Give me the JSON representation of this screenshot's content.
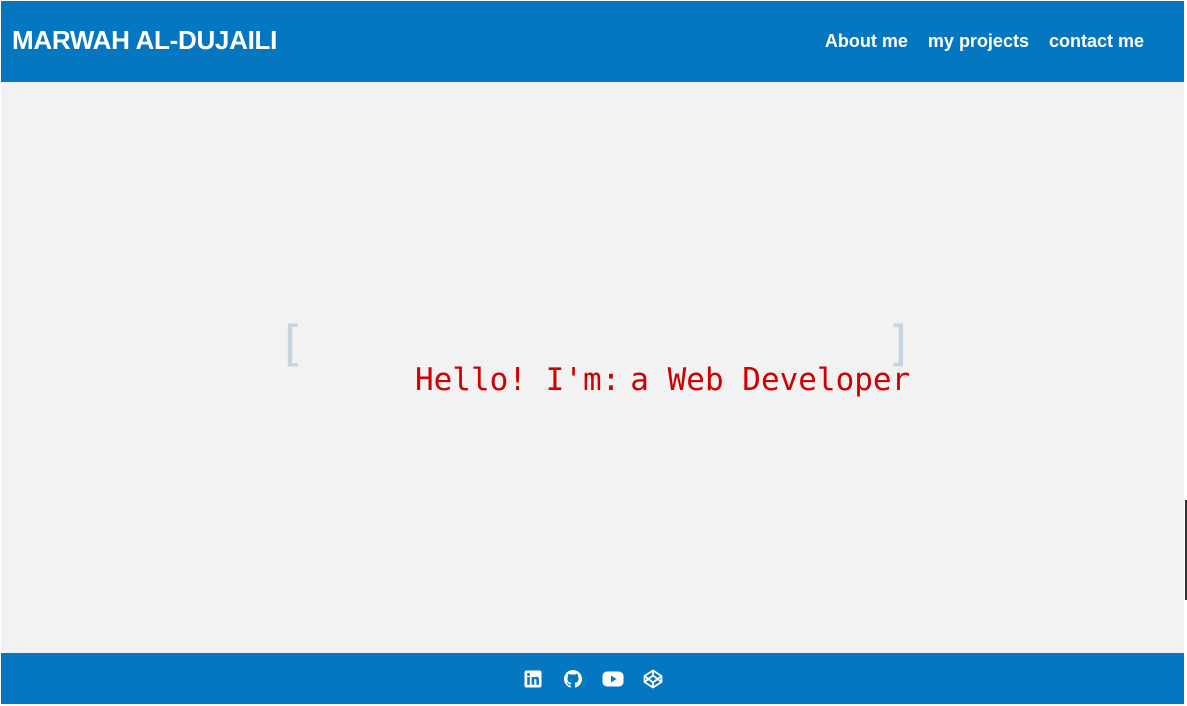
{
  "header": {
    "brand": "MARWAH AL-DUJAILI",
    "nav": [
      {
        "label": "About me"
      },
      {
        "label": "my projects"
      },
      {
        "label": "contact me"
      }
    ]
  },
  "hero": {
    "greeting": "Hello! I'm:",
    "role": "a Web Developer",
    "bracket_left": "[",
    "bracket_right": "]"
  },
  "footer": {
    "socials": [
      {
        "icon": "linkedin-icon"
      },
      {
        "icon": "github-icon"
      },
      {
        "icon": "youtube-icon"
      },
      {
        "icon": "codepen-icon"
      }
    ]
  },
  "colors": {
    "primary": "#0577c0",
    "background": "#f2f2f2",
    "accent_text": "#d00000",
    "bracket": "#c5d5e5"
  }
}
